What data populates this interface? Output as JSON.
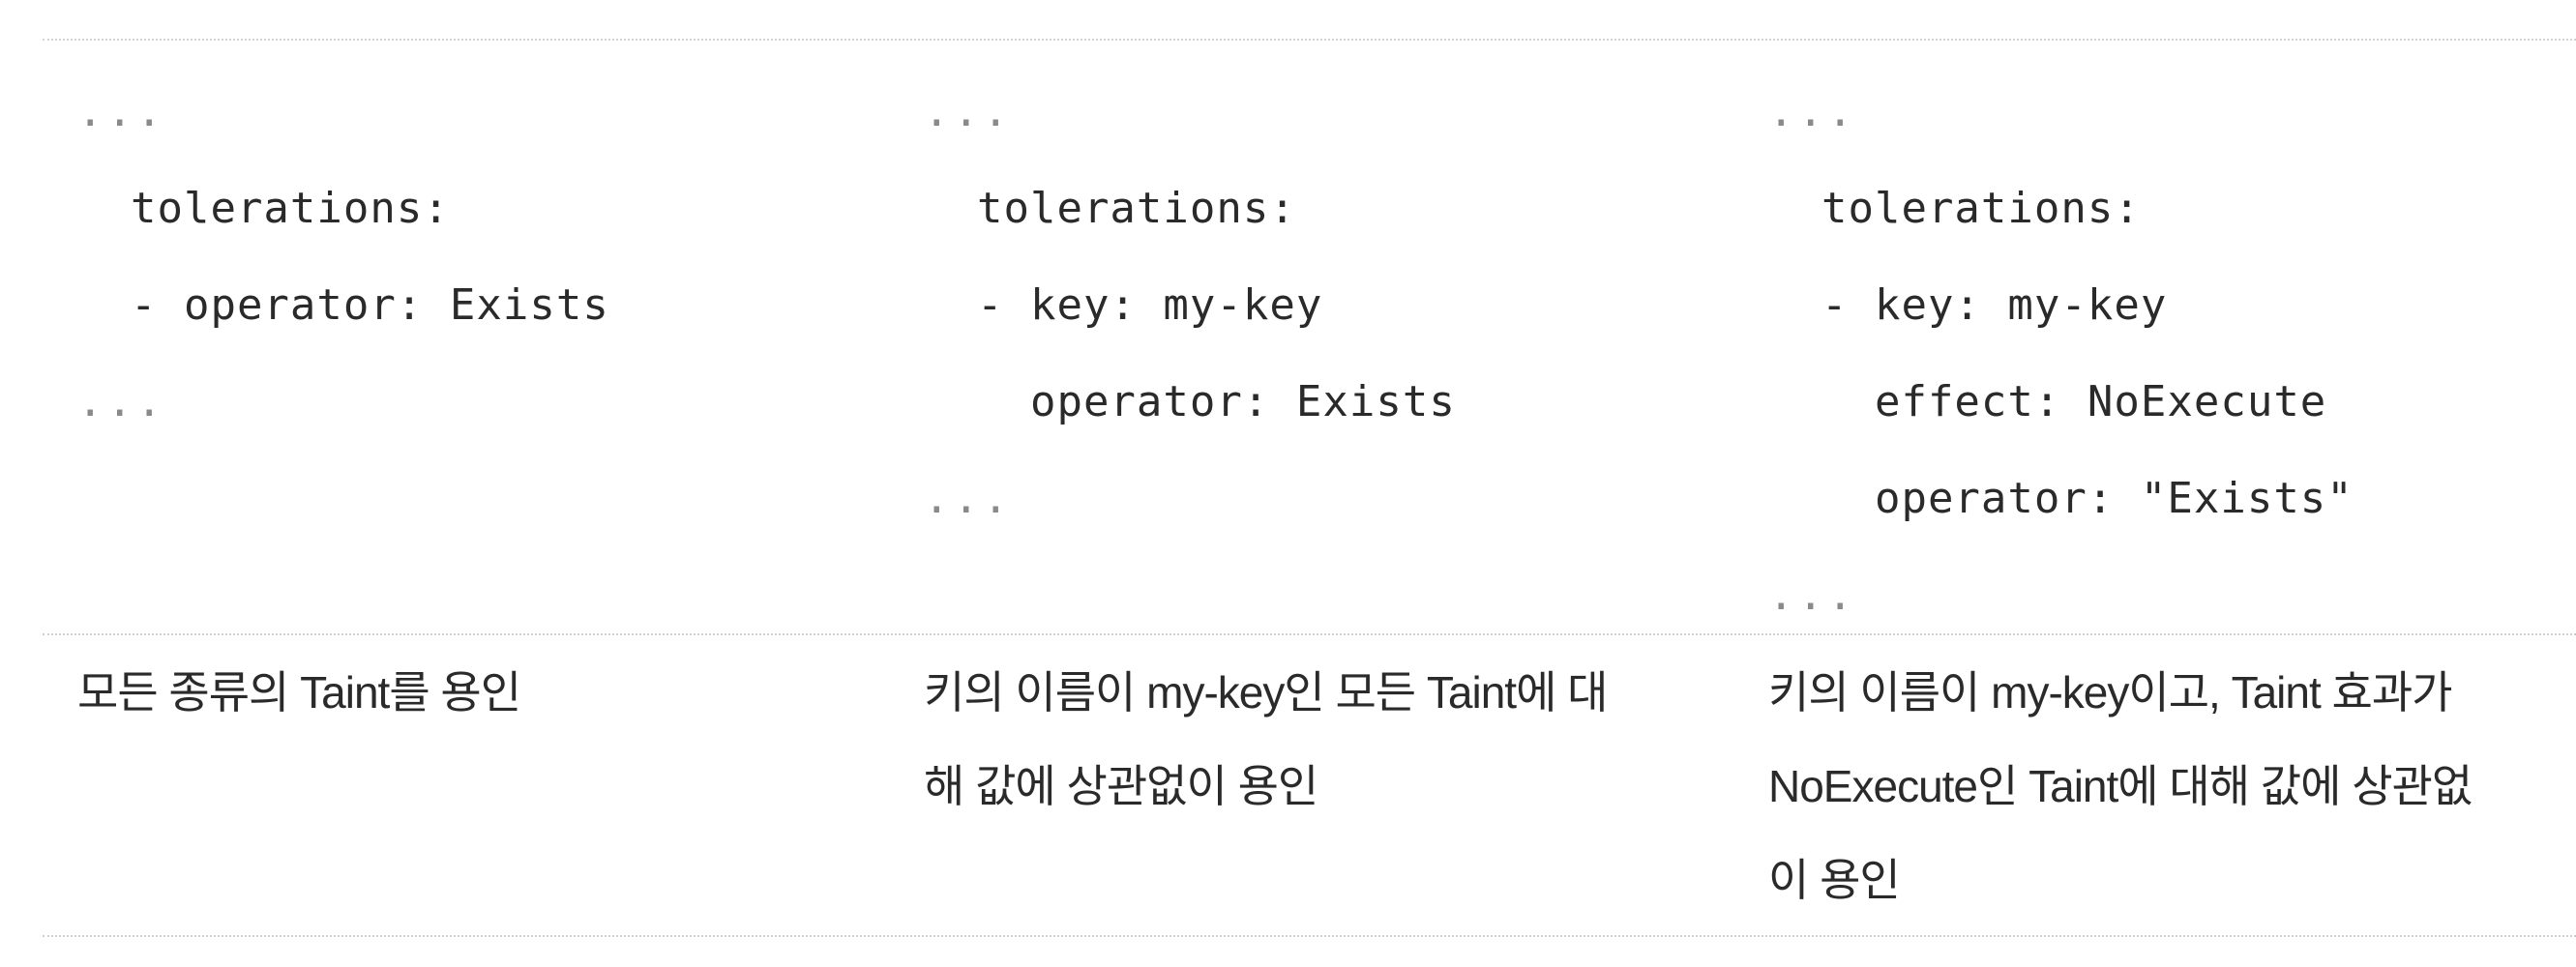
{
  "columns": [
    {
      "code": [
        "...",
        "  tolerations:",
        "  - operator: Exists",
        "..."
      ],
      "description": [
        "모든 종류의 Taint를 용인"
      ]
    },
    {
      "code": [
        "...",
        "  tolerations:",
        "  - key: my-key",
        "    operator: Exists",
        "..."
      ],
      "description": [
        "키의 이름이 my-key인 모든 Taint에 대",
        "해 값에 상관없이 용인"
      ]
    },
    {
      "code": [
        "...",
        "  tolerations:",
        "  - key: my-key",
        "    effect: NoExecute",
        "    operator: \"Exists\"",
        "..."
      ],
      "description": [
        "키의 이름이 my-key이고, Taint 효과가",
        "NoExecute인 Taint에 대해 값에 상관없",
        "이 용인"
      ]
    }
  ]
}
